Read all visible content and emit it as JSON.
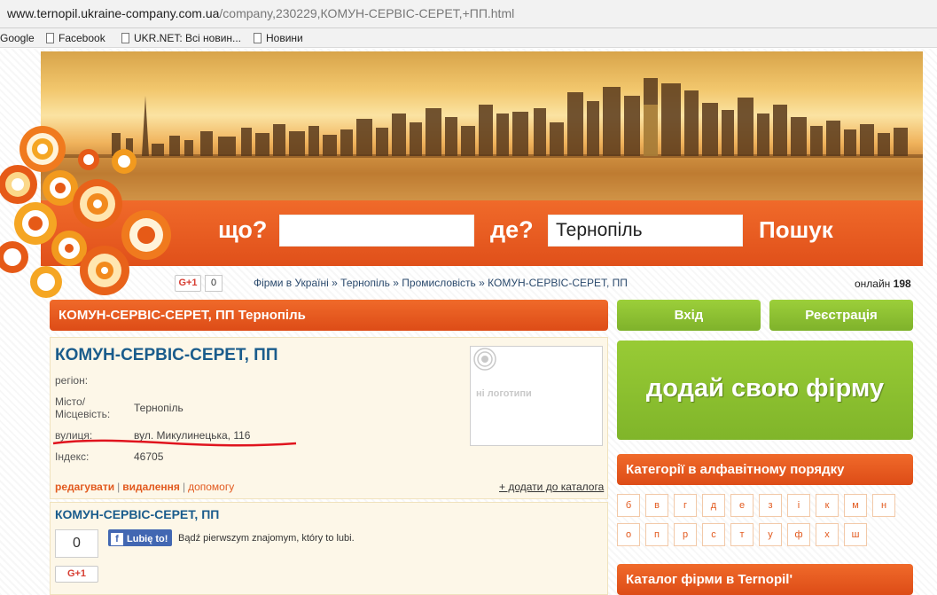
{
  "browser": {
    "url_domain": "www.ternopil.ukraine-company.com.ua",
    "url_path": "/company,230229,КОМУН-СЕРВІС-СЕРЕТ,+ПП.html",
    "bookmarks": [
      "Google",
      "Facebook",
      "UKR.NET: Всі новин...",
      "Новини"
    ]
  },
  "search": {
    "what_label": "що?",
    "what_value": "",
    "where_label": "де?",
    "where_value": "Тернопіль",
    "submit_label": "Пошук"
  },
  "social": {
    "gplus_label": "G+1",
    "gplus_count": "0"
  },
  "breadcrumb": [
    "Фірми в Україні",
    "Тернопіль",
    "Промисловість",
    "КОМУН-СЕРВІС-СЕРЕТ, ПП"
  ],
  "breadcrumb_separator": "»",
  "online": {
    "label": "онлайн",
    "count": "198"
  },
  "company": {
    "title_bar": "КОМУН-СЕРВІС-СЕРЕТ, ПП Тернопіль",
    "name": "КОМУН-СЕРВІС-СЕРЕТ, ПП",
    "fields": {
      "region_label": "регіон:",
      "city_label_1": "Місто/",
      "city_label_2": "Місцевість:",
      "city_value": "Тернопіль",
      "street_label": "вулиця:",
      "street_value": "вул. Микулинецька, 116",
      "zip_label": "Індекс:",
      "zip_value": "46705"
    },
    "logo_placeholder": "ні логотипи"
  },
  "actions": {
    "edit": "редагувати",
    "separator": "|",
    "delete": "видалення",
    "help": "допомогу",
    "add_catalog": "+ додати до каталога"
  },
  "card2": {
    "name": "КОМУН-СЕРВІС-СЕРЕТ, ПП",
    "zero_count": "0",
    "fb_like_label": "Lubię to!",
    "fb_text": "Bądź pierwszym znajomym, który to lubi.",
    "gplus_label": "G+1"
  },
  "sidebar": {
    "login": "Вхід",
    "register": "Реєстрація",
    "add_firm": "додай свою фірму",
    "categories_title": "Категорії в алфавітному порядку",
    "letters_row1": [
      "б",
      "в",
      "г",
      "д",
      "е",
      "з",
      "і",
      "к",
      "м",
      "н"
    ],
    "letters_row2": [
      "о",
      "п",
      "р",
      "с",
      "т",
      "у",
      "ф",
      "х",
      "ш"
    ],
    "catalog_title": "Каталог фірми в Ternopil'"
  },
  "colors": {
    "orange": "#e0501a",
    "green": "#8cc131",
    "blue_title": "#1a5c8c"
  }
}
